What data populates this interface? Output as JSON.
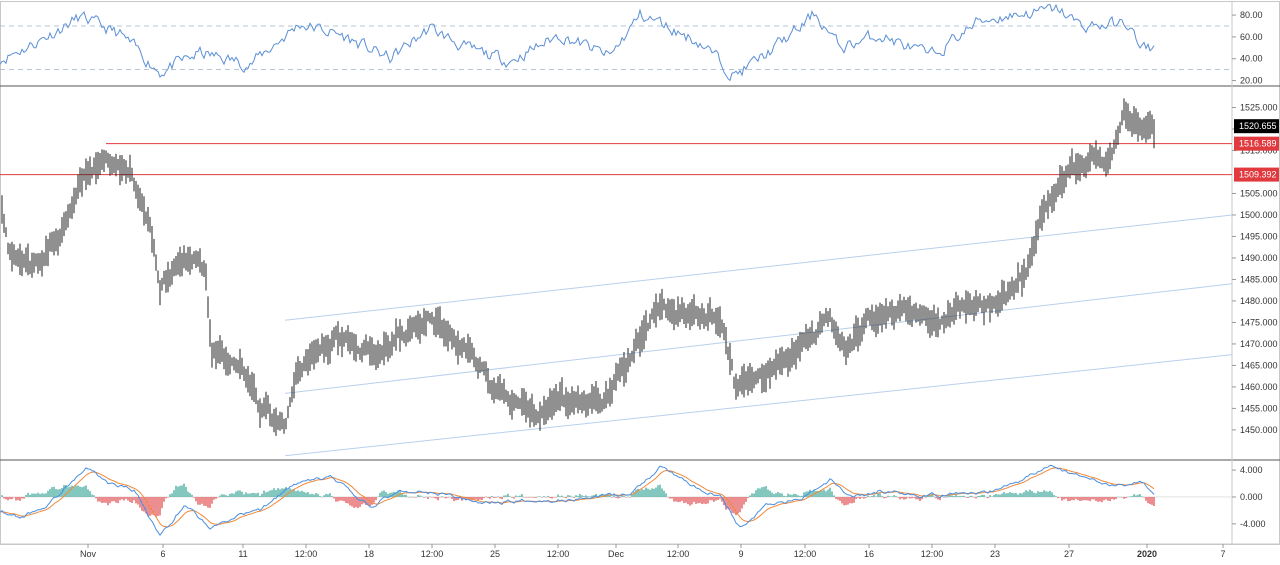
{
  "chart_data": [
    {
      "type": "line",
      "panel": "rsi",
      "y_ticks": [
        "80.00",
        "60.00",
        "40.00",
        "20.00"
      ],
      "ylim": [
        15,
        92
      ],
      "band_levels": [
        70,
        30
      ],
      "colors": {
        "line": "#5b8fd6",
        "band": "#9fb3c8"
      },
      "anchors_x": [
        0,
        30,
        80,
        120,
        160,
        200,
        250,
        300,
        340,
        390,
        430,
        470,
        510,
        560,
        610,
        640,
        655,
        700,
        735,
        760,
        800,
        815,
        840,
        880,
        930,
        980,
        1010,
        1060,
        1080,
        1130,
        1140,
        1155
      ],
      "anchors_y": [
        40,
        52,
        78,
        62,
        28,
        45,
        35,
        72,
        62,
        40,
        68,
        48,
        38,
        62,
        42,
        80,
        75,
        55,
        25,
        40,
        68,
        82,
        50,
        62,
        42,
        75,
        80,
        85,
        70,
        72,
        48,
        50
      ]
    },
    {
      "type": "candlestick",
      "panel": "price",
      "y_ticks": [
        "1525.000",
        "1520.000",
        "1515.000",
        "1505.000",
        "1500.000",
        "1495.000",
        "1490.000",
        "1485.000",
        "1480.000",
        "1475.000",
        "1470.000",
        "1465.000",
        "1460.000",
        "1455.000",
        "1450.000"
      ],
      "ylim": [
        1443,
        1530
      ],
      "last_price": "1520.655",
      "resistance_levels": [
        {
          "label": "1516.589",
          "value": 1516.589,
          "from_x": 106
        },
        {
          "label": "1509.392",
          "value": 1509.392,
          "from_x": 0
        }
      ],
      "channel_lines": [
        {
          "x1": 285,
          "y1": 1475.5,
          "x2": 1232,
          "y2": 1500.0
        },
        {
          "x1": 285,
          "y1": 1458.5,
          "x2": 1232,
          "y2": 1484.0
        },
        {
          "x1": 285,
          "y1": 1444.0,
          "x2": 1232,
          "y2": 1467.5
        }
      ],
      "anchors_x": [
        0,
        8,
        30,
        60,
        80,
        100,
        130,
        150,
        160,
        185,
        205,
        212,
        240,
        260,
        285,
        300,
        340,
        380,
        400,
        430,
        470,
        490,
        530,
        560,
        600,
        620,
        660,
        680,
        720,
        735,
        760,
        800,
        830,
        845,
        870,
        900,
        940,
        960,
        1000,
        1025,
        1040,
        1060,
        1080,
        1110,
        1125,
        1140,
        1155
      ],
      "anchors_y": [
        1505,
        1493,
        1488,
        1495,
        1508,
        1512,
        1510,
        1498,
        1484,
        1490,
        1487,
        1468,
        1466,
        1455,
        1452,
        1464,
        1472,
        1467,
        1472,
        1476,
        1468,
        1461,
        1453,
        1457,
        1456,
        1463,
        1479,
        1477,
        1476,
        1461,
        1462,
        1469,
        1476,
        1468,
        1476,
        1478,
        1475,
        1479,
        1479,
        1487,
        1499,
        1508,
        1512,
        1514,
        1524,
        1521,
        1520
      ],
      "colors": {
        "candle": "#222222",
        "level": "#e0393e",
        "channel": "#b8d0ec",
        "last_tag": "#000000"
      }
    },
    {
      "type": "line",
      "panel": "macd",
      "y_ticks": [
        "4.000",
        "0.000",
        "-4.000"
      ],
      "ylim": [
        -7,
        5.5
      ],
      "colors": {
        "macd": "#4a8fe0",
        "signal": "#f08a3c",
        "hist_pos": "#3fa89a",
        "hist_neg": "#e25052"
      },
      "anchors_x": [
        0,
        20,
        50,
        85,
        110,
        135,
        160,
        185,
        210,
        235,
        260,
        290,
        330,
        370,
        400,
        440,
        480,
        520,
        560,
        600,
        630,
        660,
        690,
        720,
        740,
        770,
        800,
        830,
        850,
        880,
        920,
        960,
        1000,
        1050,
        1080,
        1110,
        1140,
        1155
      ],
      "anchors_y": [
        -2,
        -3,
        -1,
        4.5,
        2,
        1,
        -6,
        -1,
        -4.5,
        -3,
        -2,
        1.5,
        3,
        -1.5,
        1,
        0.5,
        -1,
        -0.5,
        -0.5,
        0,
        0.5,
        4.5,
        2,
        0,
        -4.5,
        -1,
        -0.5,
        2.5,
        0,
        1,
        0,
        0.5,
        1,
        4.5,
        3,
        2,
        2,
        0.5
      ]
    }
  ],
  "x_axis": {
    "labels": [
      {
        "text": "Nov",
        "x": 88
      },
      {
        "text": "6",
        "x": 163
      },
      {
        "text": "11",
        "x": 243
      },
      {
        "text": "12:00",
        "x": 306
      },
      {
        "text": "18",
        "x": 369
      },
      {
        "text": "12:00",
        "x": 432
      },
      {
        "text": "25",
        "x": 495
      },
      {
        "text": "12:00",
        "x": 558
      },
      {
        "text": "Dec",
        "x": 616
      },
      {
        "text": "12:00",
        "x": 678
      },
      {
        "text": "9",
        "x": 741
      },
      {
        "text": "12:00",
        "x": 805
      },
      {
        "text": "16",
        "x": 869
      },
      {
        "text": "12:00",
        "x": 932
      },
      {
        "text": "23",
        "x": 995
      },
      {
        "text": "27",
        "x": 1069
      },
      {
        "text": "2020",
        "x": 1147
      },
      {
        "text": "7",
        "x": 1223
      }
    ]
  }
}
